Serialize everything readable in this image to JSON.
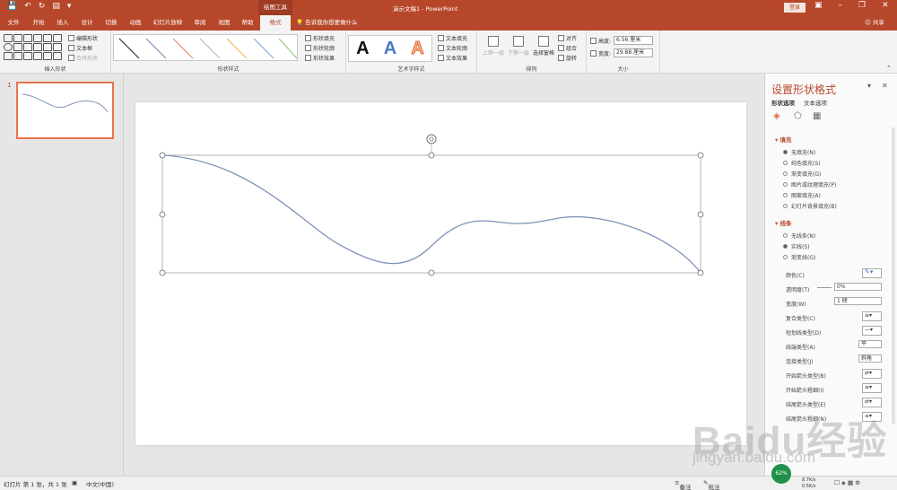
{
  "titlebar": {
    "context_tools": "绘图工具",
    "doc_title": "演示文稿1 - PowerPoint",
    "login": "登录"
  },
  "tabs": [
    {
      "label": "文件"
    },
    {
      "label": "开始"
    },
    {
      "label": "插入"
    },
    {
      "label": "设计"
    },
    {
      "label": "切换"
    },
    {
      "label": "动画"
    },
    {
      "label": "幻灯片放映"
    },
    {
      "label": "审阅"
    },
    {
      "label": "视图"
    },
    {
      "label": "帮助"
    },
    {
      "label": "格式"
    }
  ],
  "tellme": "告诉我你想要做什么",
  "share": "共享",
  "ribbon": {
    "insert_shapes": {
      "name": "插入形状",
      "edit_shape": "编辑形状",
      "textbox": "文本框",
      "merge_shapes": "合并形状"
    },
    "shape_styles": {
      "name": "形状样式",
      "fill": "形状填充",
      "outline": "形状轮廓",
      "effects": "形状效果"
    },
    "wordart": {
      "name": "艺术字样式",
      "sample": "A",
      "text_fill": "文本填充",
      "text_outline": "文本轮廓",
      "text_effects": "文本效果"
    },
    "arrange": {
      "name": "排列",
      "bring_forward": "上移一层",
      "send_backward": "下移一层",
      "selection_pane": "选择窗格",
      "align": "对齐",
      "group": "组合",
      "rotate": "旋转"
    },
    "size": {
      "name": "大小",
      "height_label": "高度:",
      "height_value": "6.56 厘米",
      "width_label": "宽度:",
      "width_value": "29.88 厘米"
    }
  },
  "thumb_number": "1",
  "pane": {
    "title": "设置形状格式",
    "tab_shape": "形状选项",
    "tab_text": "文本选项",
    "fill_section": "填充",
    "fill_options": [
      "无填充(N)",
      "纯色填充(S)",
      "渐变填充(G)",
      "图片或纹理填充(P)",
      "图案填充(A)",
      "幻灯片背景填充(B)"
    ],
    "line_section": "线条",
    "line_options": [
      "无线条(N)",
      "实线(S)",
      "渐变线(G)"
    ],
    "props": {
      "color": "颜色(C)",
      "transparency": "透明度(T)",
      "transparency_value": "0%",
      "width": "宽度(W)",
      "width_value": "1 磅",
      "compound": "复合类型(C)",
      "dash": "短划线类型(D)",
      "cap": "线端类型(A)",
      "cap_value": "平",
      "join": "连接类型(J)",
      "join_value": "斜角",
      "begin_arrow_type": "开始箭头类型(B)",
      "begin_arrow_size": "开始箭头粗细(I)",
      "end_arrow_type": "结尾箭头类型(E)",
      "end_arrow_size": "结尾箭头粗细(N)"
    }
  },
  "status": {
    "slide_info": "幻灯片 第 1 张，共 1 张",
    "language": "中文(中国)",
    "notes": "备注",
    "comments": "批注"
  },
  "tray": {
    "cpu": "62%",
    "up_speed": "8.7K/s",
    "down_speed": "0.5K/s"
  },
  "watermark": {
    "main": "Baidu经验",
    "sub": "jingyan.baidu.com"
  },
  "colors": {
    "accent": "#b7472a",
    "curve": "#7f93b8",
    "thumb_border": "#e8734f"
  }
}
